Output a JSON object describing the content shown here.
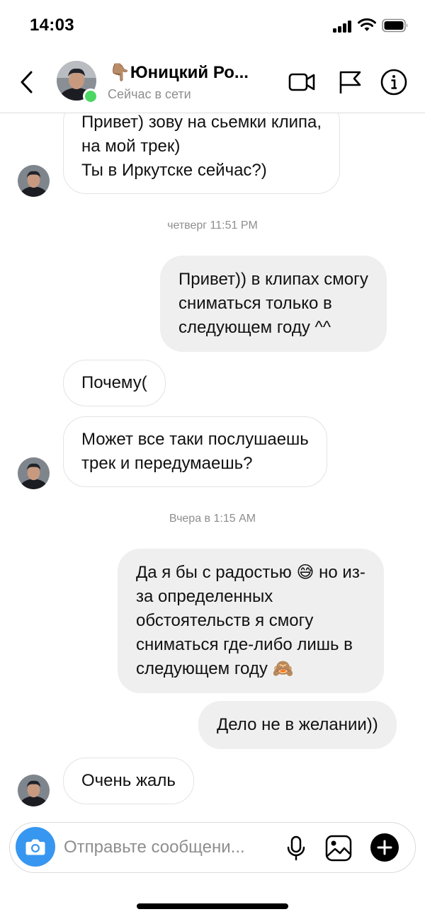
{
  "status_bar": {
    "time": "14:03"
  },
  "header": {
    "name": "👇🏽Юницкий Ро...",
    "status": "Сейчас в сети",
    "icons": [
      "back-icon",
      "video-call-icon",
      "flag-icon",
      "info-icon"
    ]
  },
  "messages": [
    {
      "from": "them",
      "lines": [
        "Привет) зову на сьемки клипа,",
        "на мой трек)",
        "Ты в Иркутске сейчас?)"
      ]
    },
    {
      "type": "timestamp",
      "text": "четверг 11:51 PM"
    },
    {
      "from": "me",
      "lines": [
        "Привет)) в клипах смогу",
        "сниматься только в",
        "следующем году ^^"
      ]
    },
    {
      "from": "them",
      "lines": [
        "Почему("
      ]
    },
    {
      "from": "them",
      "lines": [
        "Может все таки послушаешь",
        "трек и передумаешь?"
      ]
    },
    {
      "type": "timestamp",
      "text": "Вчера в 1:15 AM"
    },
    {
      "from": "me",
      "lines": [
        "Да я бы с радостью 😅 но из-",
        "за определенных",
        "обстоятельств я смогу",
        "сниматься где-либо лишь в",
        "следующем году 🙈"
      ]
    },
    {
      "from": "me",
      "lines": [
        "Дело не в желании))"
      ]
    },
    {
      "from": "them",
      "lines": [
        "Очень жаль"
      ]
    }
  ],
  "composer": {
    "placeholder": "Отправьте сообщени...",
    "icons": [
      "camera-icon",
      "microphone-icon",
      "gallery-icon",
      "plus-icon"
    ]
  },
  "colors": {
    "accent": "#3797f0",
    "online": "#4bd763",
    "outgoing_bubble": "#efefef",
    "muted_text": "#8e8e8e"
  }
}
